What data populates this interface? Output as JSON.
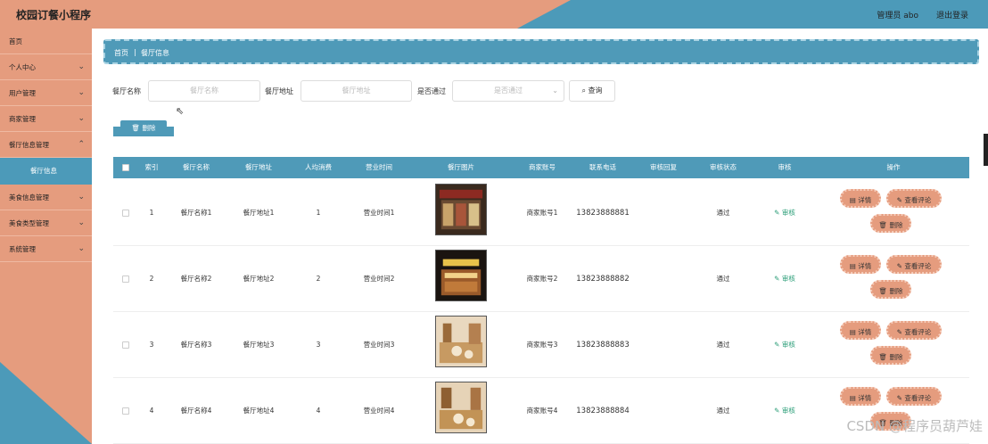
{
  "header": {
    "title": "校园订餐小程序",
    "admin_label": "管理员 abo",
    "logout_label": "退出登录",
    "colors": {
      "orange": "#e59c7e",
      "blue": "#4c9ab9"
    }
  },
  "sidebar": {
    "items": [
      {
        "label": "首页",
        "chevron": false
      },
      {
        "label": "个人中心",
        "chevron": true
      },
      {
        "label": "用户管理",
        "chevron": true
      },
      {
        "label": "商家管理",
        "chevron": true
      },
      {
        "label": "餐厅信息管理",
        "chevron": true
      },
      {
        "label": "美食信息管理",
        "chevron": true
      },
      {
        "label": "美食类型管理",
        "chevron": true
      },
      {
        "label": "系统管理",
        "chevron": true
      }
    ],
    "active_sub": "餐厅信息"
  },
  "breadcrumb": {
    "home": "首页",
    "separator": "|",
    "current": "餐厅信息"
  },
  "search": {
    "name_label": "餐厅名称",
    "name_placeholder": "餐厅名称",
    "addr_label": "餐厅地址",
    "addr_placeholder": "餐厅地址",
    "pass_label": "是否通过",
    "pass_placeholder": "是否通过",
    "query_label": "查询"
  },
  "delete_label": "删除",
  "table": {
    "headers": [
      "索引",
      "餐厅名称",
      "餐厅地址",
      "人均消费",
      "营业时间",
      "餐厅图片",
      "商家账号",
      "联系电话",
      "审核回复",
      "审核状态",
      "审核",
      "操作"
    ],
    "rows": [
      {
        "index": "1",
        "name": "餐厅名称1",
        "addr": "餐厅地址1",
        "avg": "1",
        "hours": "营业时间1",
        "merchant": "商家账号1",
        "phone": "13823888881",
        "reply": "",
        "status": "通过",
        "audit": "审核"
      },
      {
        "index": "2",
        "name": "餐厅名称2",
        "addr": "餐厅地址2",
        "avg": "2",
        "hours": "营业时间2",
        "merchant": "商家账号2",
        "phone": "13823888882",
        "reply": "",
        "status": "通过",
        "audit": "审核"
      },
      {
        "index": "3",
        "name": "餐厅名称3",
        "addr": "餐厅地址3",
        "avg": "3",
        "hours": "营业时间3",
        "merchant": "商家账号3",
        "phone": "13823888883",
        "reply": "",
        "status": "通过",
        "audit": "审核"
      },
      {
        "index": "4",
        "name": "餐厅名称4",
        "addr": "餐厅地址4",
        "avg": "4",
        "hours": "营业时间4",
        "merchant": "商家账号4",
        "phone": "13823888884",
        "reply": "",
        "status": "通过",
        "audit": "审核"
      }
    ],
    "ops": {
      "detail": "详情",
      "review": "查看评论",
      "delete": "删除"
    }
  },
  "watermark": "CSDN @程序员葫芦娃"
}
